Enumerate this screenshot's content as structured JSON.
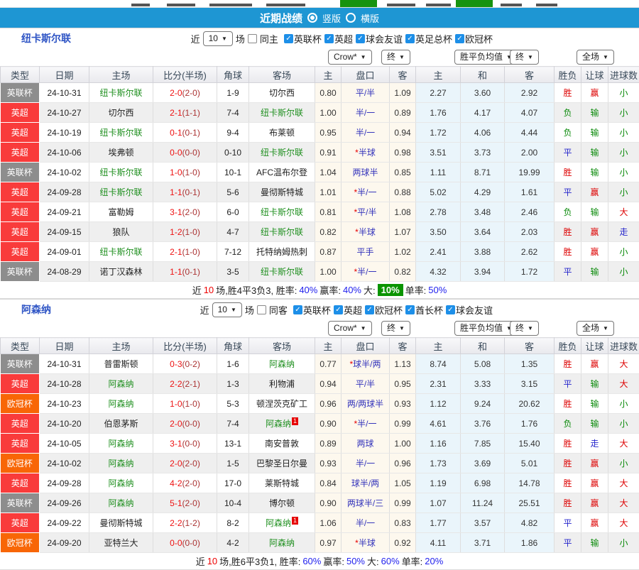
{
  "toolbar": {
    "title": "近期战绩",
    "options": [
      {
        "label": "竖版",
        "selected": true
      },
      {
        "label": "横版",
        "selected": false
      }
    ]
  },
  "colors": {
    "bar_blue": "#1e96d3",
    "league_epl": "#f93b3b",
    "league_league_cup": "#8d8d8d",
    "league_ucl": "#f86606",
    "focus_team_green": "#1f8f1f",
    "score_red": "#ee1111",
    "win_red": "#dd0000",
    "lose_green": "#0a8a0a",
    "draw_blue": "#2626cc",
    "summary_highlight_green": "#0a9400"
  },
  "columns": [
    "类型",
    "日期",
    "主场",
    "比分(半场)",
    "角球",
    "客场",
    "主",
    "盘口",
    "客",
    "主",
    "和",
    "客",
    "胜负",
    "让球",
    "进球数"
  ],
  "sections": [
    {
      "team": "纽卡斯尔联",
      "filter": {
        "near": "近",
        "count": "10",
        "games": "场",
        "same": "同主",
        "leagues": [
          "英联杯",
          "英超",
          "球会友谊",
          "英足总杯",
          "欧冠杯"
        ]
      },
      "selects": [
        "Crow*",
        "终",
        "胜平负均值",
        "终",
        "全场"
      ],
      "rows": [
        {
          "league": "英联杯",
          "date": "24-10-31",
          "home": "纽卡斯尔联",
          "score": "2-0",
          "half": "(2-0)",
          "corner": "1-9",
          "away": "切尔西",
          "ah": "0.80",
          "hcap": "平/半",
          "aa": "1.09",
          "eh": "2.27",
          "ed": "3.60",
          "ea": "2.92",
          "res": "胜",
          "hres": "赢",
          "goals": "小",
          "home_badge": "",
          "away_badge": ""
        },
        {
          "league": "英超",
          "date": "24-10-27",
          "home": "切尔西",
          "score": "2-1",
          "half": "(1-1)",
          "corner": "7-4",
          "away": "纽卡斯尔联",
          "ah": "1.00",
          "hcap": "半/一",
          "aa": "0.89",
          "eh": "1.76",
          "ed": "4.17",
          "ea": "4.07",
          "res": "负",
          "hres": "输",
          "goals": "小",
          "home_badge": "",
          "away_badge": ""
        },
        {
          "league": "英超",
          "date": "24-10-19",
          "home": "纽卡斯尔联",
          "score": "0-1",
          "half": "(0-1)",
          "corner": "9-4",
          "away": "布莱顿",
          "ah": "0.95",
          "hcap": "半/一",
          "aa": "0.94",
          "eh": "1.72",
          "ed": "4.06",
          "ea": "4.44",
          "res": "负",
          "hres": "输",
          "goals": "小",
          "home_badge": "",
          "away_badge": ""
        },
        {
          "league": "英超",
          "date": "24-10-06",
          "home": "埃弗顿",
          "score": "0-0",
          "half": "(0-0)",
          "corner": "0-10",
          "away": "纽卡斯尔联",
          "ah": "0.91",
          "hcap": "*半球",
          "aa": "0.98",
          "eh": "3.51",
          "ed": "3.73",
          "ea": "2.00",
          "res": "平",
          "hres": "输",
          "goals": "小",
          "home_badge": "",
          "away_badge": ""
        },
        {
          "league": "英联杯",
          "date": "24-10-02",
          "home": "纽卡斯尔联",
          "score": "1-0",
          "half": "(1-0)",
          "corner": "10-1",
          "away": "AFC温布尔登",
          "ah": "1.04",
          "hcap": "两球半",
          "aa": "0.85",
          "eh": "1.11",
          "ed": "8.71",
          "ea": "19.99",
          "res": "胜",
          "hres": "输",
          "goals": "小",
          "home_badge": "",
          "away_badge": ""
        },
        {
          "league": "英超",
          "date": "24-09-28",
          "home": "纽卡斯尔联",
          "score": "1-1",
          "half": "(0-1)",
          "corner": "5-6",
          "away": "曼彻斯特城",
          "ah": "1.01",
          "hcap": "*半/一",
          "aa": "0.88",
          "eh": "5.02",
          "ed": "4.29",
          "ea": "1.61",
          "res": "平",
          "hres": "赢",
          "goals": "小",
          "home_badge": "",
          "away_badge": ""
        },
        {
          "league": "英超",
          "date": "24-09-21",
          "home": "富勒姆",
          "score": "3-1",
          "half": "(2-0)",
          "corner": "6-0",
          "away": "纽卡斯尔联",
          "ah": "0.81",
          "hcap": "*平/半",
          "aa": "1.08",
          "eh": "2.78",
          "ed": "3.48",
          "ea": "2.46",
          "res": "负",
          "hres": "输",
          "goals": "大",
          "home_badge": "",
          "away_badge": ""
        },
        {
          "league": "英超",
          "date": "24-09-15",
          "home": "狼队",
          "score": "1-2",
          "half": "(1-0)",
          "corner": "4-7",
          "away": "纽卡斯尔联",
          "ah": "0.82",
          "hcap": "*半球",
          "aa": "1.07",
          "eh": "3.50",
          "ed": "3.64",
          "ea": "2.03",
          "res": "胜",
          "hres": "赢",
          "goals": "走",
          "home_badge": "",
          "away_badge": ""
        },
        {
          "league": "英超",
          "date": "24-09-01",
          "home": "纽卡斯尔联",
          "score": "2-1",
          "half": "(1-0)",
          "corner": "7-12",
          "away": "托特纳姆热刺",
          "ah": "0.87",
          "hcap": "平手",
          "aa": "1.02",
          "eh": "2.41",
          "ed": "3.88",
          "ea": "2.62",
          "res": "胜",
          "hres": "赢",
          "goals": "小",
          "home_badge": "",
          "away_badge": ""
        },
        {
          "league": "英联杯",
          "date": "24-08-29",
          "home": "诺丁汉森林",
          "score": "1-1",
          "half": "(0-1)",
          "corner": "3-5",
          "away": "纽卡斯尔联",
          "ah": "1.00",
          "hcap": "*半/一",
          "aa": "0.82",
          "eh": "4.32",
          "ed": "3.94",
          "ea": "1.72",
          "res": "平",
          "hres": "输",
          "goals": "小",
          "home_badge": "",
          "away_badge": ""
        }
      ],
      "summary": {
        "pre": "近",
        "count": "10",
        "mid": "场,胜4平3负3, 胜率:",
        "win": "40%",
        "l2": "赢率:",
        "profit": "40%",
        "l3": "大:",
        "big": "10%",
        "big_box": true,
        "l4": "单率:",
        "single": "50%"
      }
    },
    {
      "team": "阿森纳",
      "filter": {
        "near": "近",
        "count": "10",
        "games": "场",
        "same": "同客",
        "leagues": [
          "英联杯",
          "英超",
          "欧冠杯",
          "酋长杯",
          "球会友谊"
        ]
      },
      "selects": [
        "Crow*",
        "终",
        "胜平负均值",
        "终",
        "全场"
      ],
      "rows": [
        {
          "league": "英联杯",
          "date": "24-10-31",
          "home": "普雷斯顿",
          "score": "0-3",
          "half": "(0-2)",
          "corner": "1-6",
          "away": "阿森纳",
          "ah": "0.77",
          "hcap": "*球半/两",
          "aa": "1.13",
          "eh": "8.74",
          "ed": "5.08",
          "ea": "1.35",
          "res": "胜",
          "hres": "赢",
          "goals": "大",
          "home_badge": "",
          "away_badge": ""
        },
        {
          "league": "英超",
          "date": "24-10-28",
          "home": "阿森纳",
          "score": "2-2",
          "half": "(2-1)",
          "corner": "1-3",
          "away": "利物浦",
          "ah": "0.94",
          "hcap": "平/半",
          "aa": "0.95",
          "eh": "2.31",
          "ed": "3.33",
          "ea": "3.15",
          "res": "平",
          "hres": "输",
          "goals": "大",
          "home_badge": "",
          "away_badge": ""
        },
        {
          "league": "欧冠杯",
          "date": "24-10-23",
          "home": "阿森纳",
          "score": "1-0",
          "half": "(1-0)",
          "corner": "5-3",
          "away": "顿涅茨克矿工",
          "ah": "0.96",
          "hcap": "两/两球半",
          "aa": "0.93",
          "eh": "1.12",
          "ed": "9.24",
          "ea": "20.62",
          "res": "胜",
          "hres": "输",
          "goals": "小",
          "home_badge": "",
          "away_badge": ""
        },
        {
          "league": "英超",
          "date": "24-10-20",
          "home": "伯恩茅斯",
          "score": "2-0",
          "half": "(0-0)",
          "corner": "7-4",
          "away": "阿森纳",
          "ah": "0.90",
          "hcap": "*半/一",
          "aa": "0.99",
          "eh": "4.61",
          "ed": "3.76",
          "ea": "1.76",
          "res": "负",
          "hres": "输",
          "goals": "小",
          "home_badge": "",
          "away_badge": "1"
        },
        {
          "league": "英超",
          "date": "24-10-05",
          "home": "阿森纳",
          "score": "3-1",
          "half": "(0-0)",
          "corner": "13-1",
          "away": "南安普敦",
          "ah": "0.89",
          "hcap": "两球",
          "aa": "1.00",
          "eh": "1.16",
          "ed": "7.85",
          "ea": "15.40",
          "res": "胜",
          "hres": "走",
          "goals": "大",
          "home_badge": "",
          "away_badge": ""
        },
        {
          "league": "欧冠杯",
          "date": "24-10-02",
          "home": "阿森纳",
          "score": "2-0",
          "half": "(2-0)",
          "corner": "1-5",
          "away": "巴黎圣日尔曼",
          "ah": "0.93",
          "hcap": "半/一",
          "aa": "0.96",
          "eh": "1.73",
          "ed": "3.69",
          "ea": "5.01",
          "res": "胜",
          "hres": "赢",
          "goals": "小",
          "home_badge": "",
          "away_badge": ""
        },
        {
          "league": "英超",
          "date": "24-09-28",
          "home": "阿森纳",
          "score": "4-2",
          "half": "(2-0)",
          "corner": "17-0",
          "away": "莱斯特城",
          "ah": "0.84",
          "hcap": "球半/两",
          "aa": "1.05",
          "eh": "1.19",
          "ed": "6.98",
          "ea": "14.78",
          "res": "胜",
          "hres": "赢",
          "goals": "大",
          "home_badge": "",
          "away_badge": ""
        },
        {
          "league": "英联杯",
          "date": "24-09-26",
          "home": "阿森纳",
          "score": "5-1",
          "half": "(2-0)",
          "corner": "10-4",
          "away": "博尔顿",
          "ah": "0.90",
          "hcap": "两球半/三",
          "aa": "0.99",
          "eh": "1.07",
          "ed": "11.24",
          "ea": "25.51",
          "res": "胜",
          "hres": "赢",
          "goals": "大",
          "home_badge": "",
          "away_badge": ""
        },
        {
          "league": "英超",
          "date": "24-09-22",
          "home": "曼彻斯特城",
          "score": "2-2",
          "half": "(1-2)",
          "corner": "8-2",
          "away": "阿森纳",
          "ah": "1.06",
          "hcap": "半/一",
          "aa": "0.83",
          "eh": "1.77",
          "ed": "3.57",
          "ea": "4.82",
          "res": "平",
          "hres": "赢",
          "goals": "大",
          "home_badge": "",
          "away_badge": "1"
        },
        {
          "league": "欧冠杯",
          "date": "24-09-20",
          "home": "亚特兰大",
          "score": "0-0",
          "half": "(0-0)",
          "corner": "4-2",
          "away": "阿森纳",
          "ah": "0.97",
          "hcap": "*半球",
          "aa": "0.92",
          "eh": "4.11",
          "ed": "3.71",
          "ea": "1.86",
          "res": "平",
          "hres": "输",
          "goals": "小",
          "home_badge": "",
          "away_badge": ""
        }
      ],
      "summary": {
        "pre": "近",
        "count": "10",
        "mid": "场,胜6平3负1, 胜率:",
        "win": "60%",
        "l2": "赢率:",
        "profit": "50%",
        "l3": "大:",
        "big": "60%",
        "big_box": false,
        "l4": "单率:",
        "single": "20%"
      }
    }
  ]
}
